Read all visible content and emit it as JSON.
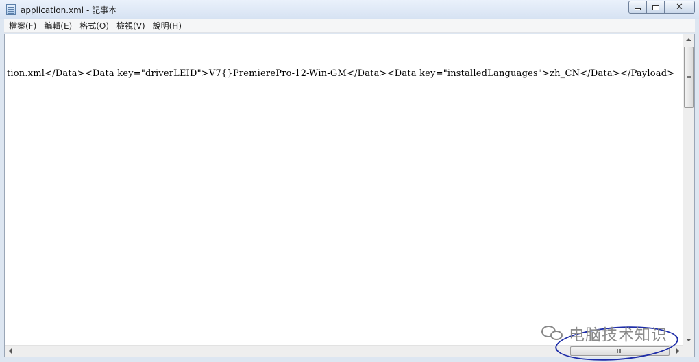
{
  "window": {
    "title": "application.xml - 記事本",
    "icon": "notepad-icon"
  },
  "menu": {
    "items": [
      {
        "label": "檔案(F)"
      },
      {
        "label": "編輯(E)"
      },
      {
        "label": "格式(O)"
      },
      {
        "label": "檢視(V)"
      },
      {
        "label": "說明(H)"
      }
    ]
  },
  "editor": {
    "line1": "tion.xml</Data><Data key=\"driverLEID\">V7{}PremierePro-12-Win-GM</Data><Data key=\"installedLanguages\">zh_CN</Data></Payload>"
  },
  "watermark": {
    "text": "电脑技术知识",
    "icon": "wechat-icon"
  },
  "colors": {
    "annotation": "#1f2ea8",
    "titlebar": "#d6e2f2"
  }
}
